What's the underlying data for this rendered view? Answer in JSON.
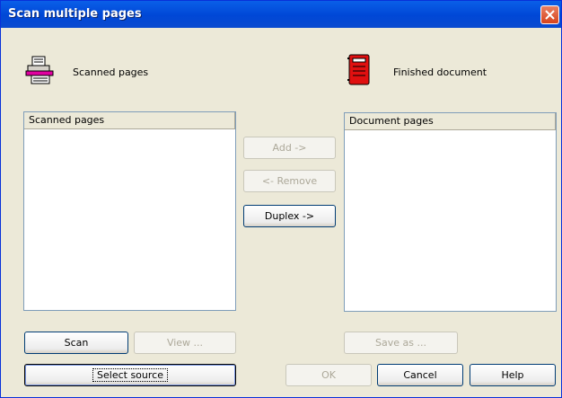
{
  "window": {
    "title": "Scan multiple pages"
  },
  "left_panel": {
    "heading": "Scanned pages",
    "list_header": "Scanned pages"
  },
  "right_panel": {
    "heading": "Finished document",
    "list_header": "Document pages"
  },
  "buttons": {
    "add": "Add ->",
    "remove": "<- Remove",
    "duplex": "Duplex ->",
    "scan": "Scan",
    "view": "View ...",
    "save_as": "Save as ...",
    "select_source": "Select source",
    "ok": "OK",
    "cancel": "Cancel",
    "help": "Help"
  }
}
